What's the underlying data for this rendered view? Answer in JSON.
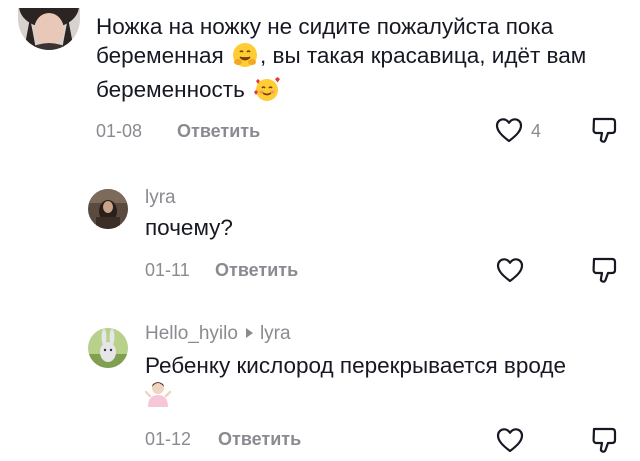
{
  "comments": [
    {
      "text": "Ножка на ножку не сидите пожалуйста пока беременная",
      "text_tail_1": ", вы такая красавица, идёт вам беременность",
      "emoji_1": "hugging-face",
      "emoji_2": "smiling-face-with-hearts",
      "date": "01-08",
      "reply_label": "Ответить",
      "likes": "4"
    },
    {
      "username": "lyra",
      "text": "почему?",
      "date": "01-11",
      "reply_label": "Ответить"
    },
    {
      "username": "Hello_hyilo",
      "reply_to": "lyra",
      "text": "Ребенку кислород перекрывается вроде",
      "emoji_1": "person-shrugging",
      "date": "01-12",
      "reply_label": "Ответить"
    }
  ],
  "colors": {
    "text": "#161823",
    "meta": "#8a8b91",
    "icon": "#161823"
  }
}
